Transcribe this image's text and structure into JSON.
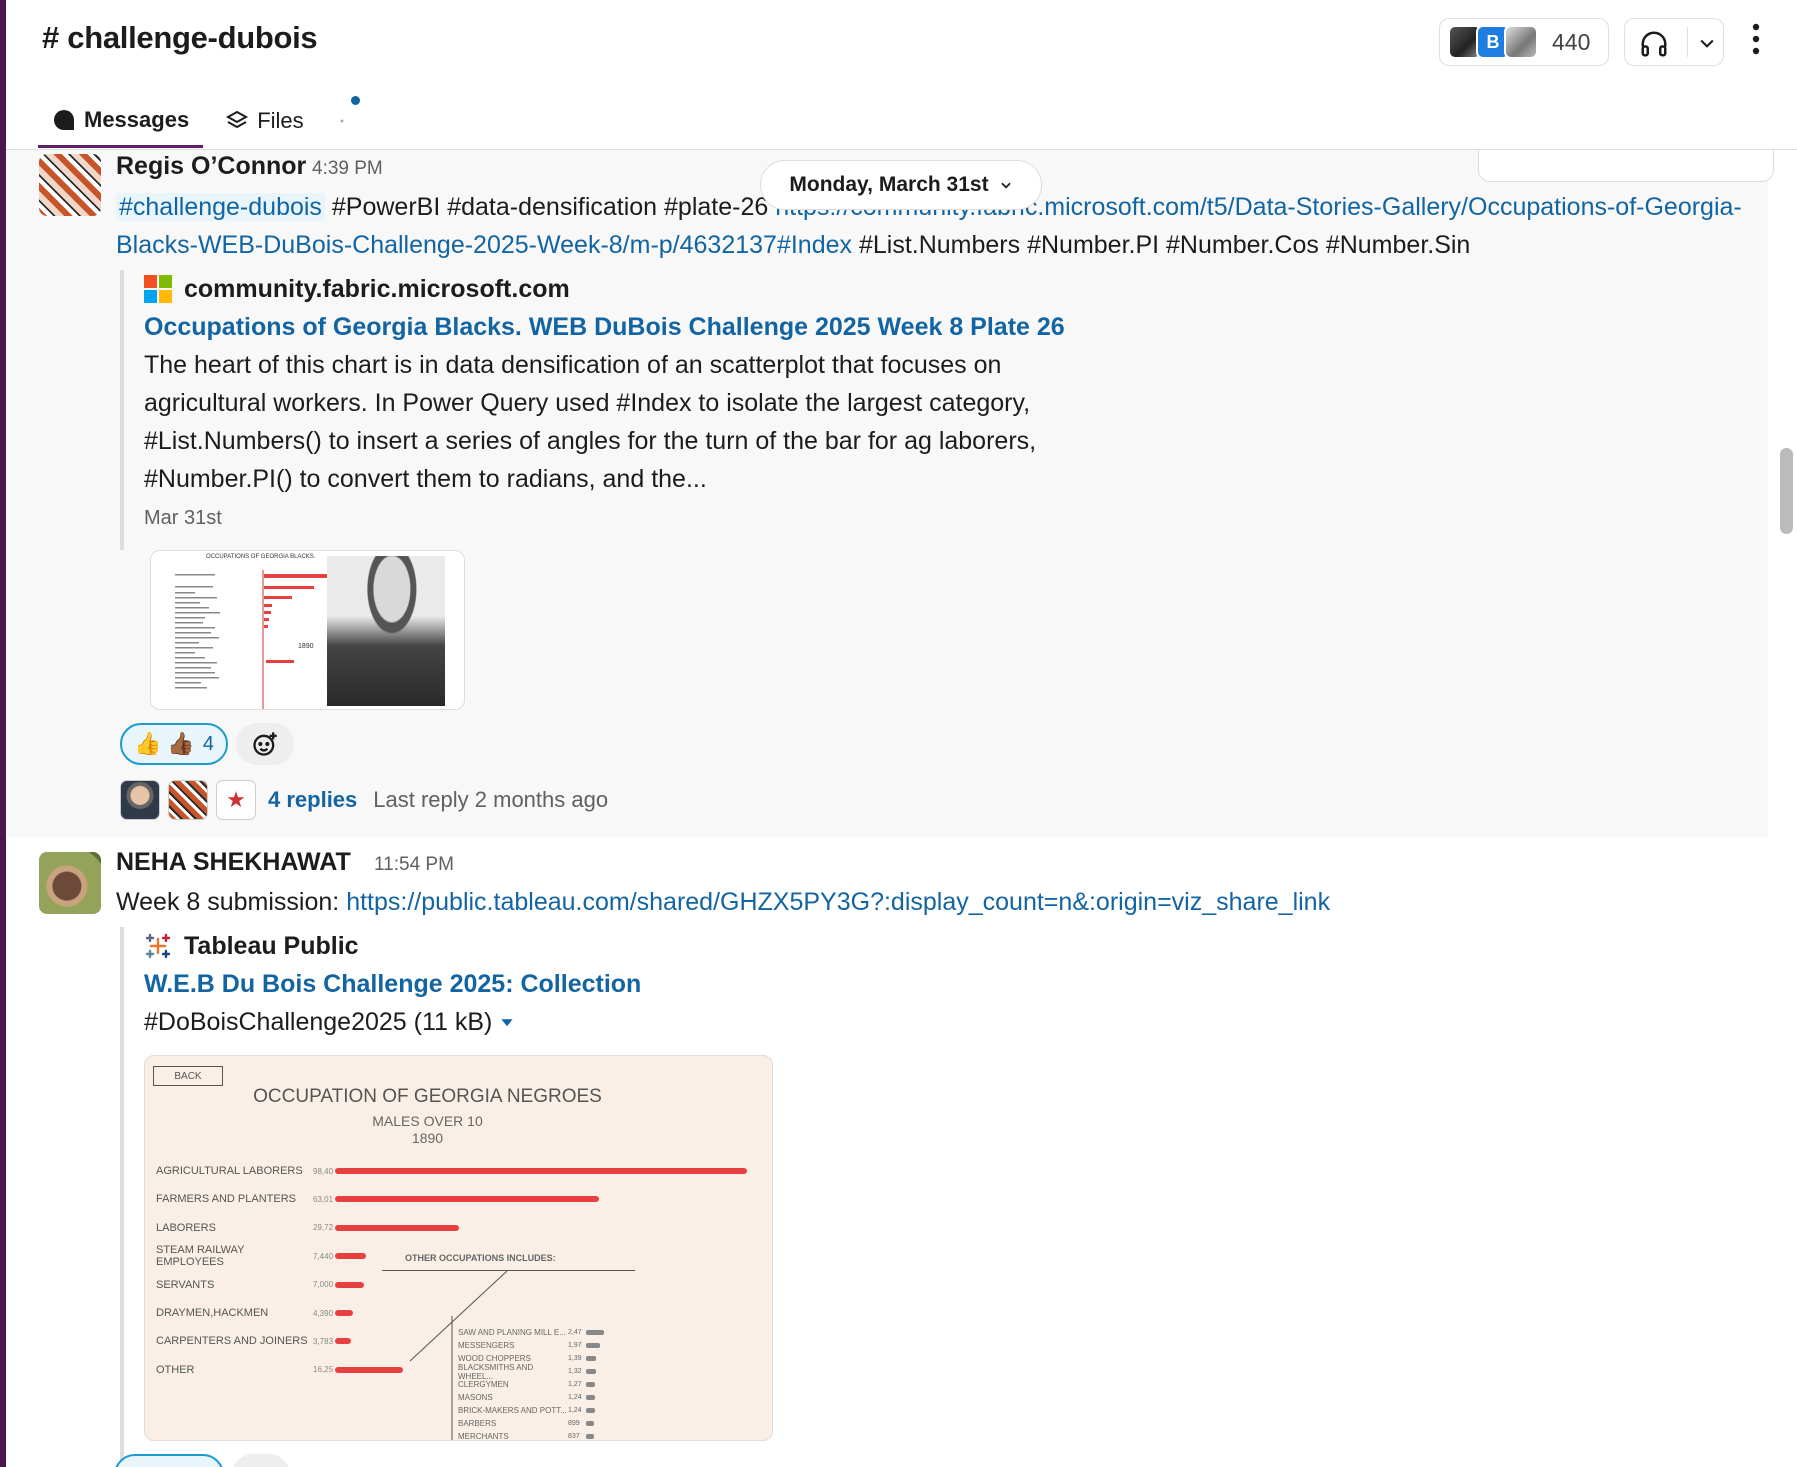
{
  "header": {
    "channel_title": "# challenge-dubois",
    "member_count": "440",
    "member_avatar_letter": "B"
  },
  "tabs": [
    {
      "label": "Messages",
      "active": true
    },
    {
      "label": "Files",
      "active": false
    }
  ],
  "date_divider": "Monday, March 31st",
  "message1": {
    "author": "Regis O’Connor",
    "time": "4:39 PM",
    "channel_mention": "#challenge-dubois",
    "text_tags": " #PowerBI #data-densification #plate-26 ",
    "link": "https://community.fabric.microsoft.com/t5/Data-Stories-Gallery/Occupations-of-Georgia-Blacks-WEB-DuBois-Challenge-2025-Week-8/m-p/4632137#Index",
    "text_tail": " #List.Numbers #Number.PI #Number.Cos #Number.Sin",
    "unfurl": {
      "site": "community.fabric.microsoft.com",
      "title": "Occupations of Georgia Blacks. WEB DuBois Challenge 2025 Week 8 Plate 26",
      "description": "The heart of this chart is in data densification of an scatterplot that focuses on agricultural workers. In Power Query  used #Index to isolate the largest category, #List.Numbers() to insert a series of angles for the turn of the bar for ag laborers, #Number.PI() to convert them to radians, and the...",
      "date": "Mar 31st",
      "thumbnail_title": "OCCUPATIONS OF GEORGIA BLACKS.",
      "thumbnail_year": "1890"
    },
    "reaction_count": "4",
    "thread": {
      "replies": "4 replies",
      "last_reply": "Last reply 2 months ago"
    }
  },
  "message2": {
    "author": "NEHA SHEKHAWAT",
    "time": "11:54 PM",
    "text_prefix": "Week 8 submission: ",
    "link": "https://public.tableau.com/shared/GHZX5PY3G?:display_count=n&:origin=viz_share_link",
    "unfurl": {
      "site": "Tableau Public",
      "title": "W.E.B Du Bois Challenge 2025: Collection",
      "file": "#DoBoisChallenge2025 (11 kB)"
    },
    "viz": {
      "back_label": "BACK",
      "title": "OCCUPATION OF GEORGIA NEGROES",
      "subtitle1": "MALES OVER 10",
      "subtitle2": "1890",
      "other_title": "OTHER OCCUPATIONS INCLUDES:",
      "rows": [
        {
          "label": "AGRICULTURAL LABORERS",
          "value": "98,40",
          "n": 98400
        },
        {
          "label": "FARMERS AND PLANTERS",
          "value": "63,01",
          "n": 63010
        },
        {
          "label": "LABORERS",
          "value": "29,72",
          "n": 29720
        },
        {
          "label": "STEAM RAILWAY EMPLOYEES",
          "value": "7,440",
          "n": 7440
        },
        {
          "label": "SERVANTS",
          "value": "7,000",
          "n": 7000
        },
        {
          "label": "DRAYMEN,HACKMEN",
          "value": "4,390",
          "n": 4390
        },
        {
          "label": "CARPENTERS AND JOINERS",
          "value": "3,783",
          "n": 3783
        },
        {
          "label": "OTHER",
          "value": "16,25",
          "n": 16250
        }
      ],
      "other_rows": [
        {
          "label": "SAW AND PLANING MILL E...",
          "value": "2,47",
          "n": 2470
        },
        {
          "label": "MESSENGERS",
          "value": "1,97",
          "n": 1970
        },
        {
          "label": "WOOD CHOPPERS",
          "value": "1,39",
          "n": 1390
        },
        {
          "label": "BLACKSMITHS AND WHEEL...",
          "value": "1,32",
          "n": 1320
        },
        {
          "label": "CLERGYMEN",
          "value": "1,27",
          "n": 1270
        },
        {
          "label": "MASONS",
          "value": "1,24",
          "n": 1240
        },
        {
          "label": "BRICK-MAKERS AND POTT...",
          "value": "1,24",
          "n": 1240
        },
        {
          "label": "BARBERS",
          "value": "899",
          "n": 899
        },
        {
          "label": "MERCHANTS",
          "value": "837",
          "n": 837
        }
      ]
    }
  },
  "colors": {
    "link": "#1264a3",
    "rail": "#4a154b",
    "active_tab": "#611f69",
    "bar": "#e84040"
  }
}
